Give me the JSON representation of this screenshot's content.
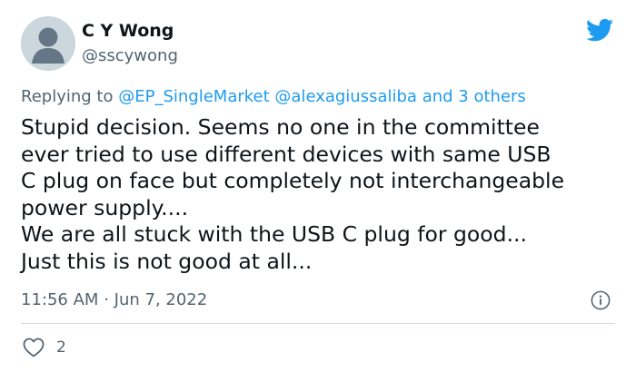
{
  "tweet": {
    "author_name": "C Y Wong",
    "author_handle": "@sscywong",
    "replying_prefix": "Replying to",
    "replying_mentions": [
      "@EP_SingleMarket",
      "@alexagiussaliba"
    ],
    "replying_suffix": "and 3 others",
    "text_lines": [
      "Stupid decision. Seems no one in the committee",
      "ever tried to use different devices with same USB",
      "C plug on face but completely not interchangeable",
      "power supply....",
      "We are all stuck with the USB C plug for good...",
      "Just this is not good at all..."
    ],
    "time": "11:56 AM",
    "separator": "·",
    "date": "Jun 7, 2022",
    "like_count": "2"
  },
  "icons": {
    "brand": "twitter-bird-icon",
    "info": "info-icon",
    "like": "heart-icon",
    "avatar": "default-profile-avatar"
  },
  "colors": {
    "brand_blue": "#1d9bf0",
    "secondary_text": "#536471",
    "primary_text": "#0f1419",
    "divider": "#cfd9de",
    "avatar_bg": "#ccd6dd"
  }
}
